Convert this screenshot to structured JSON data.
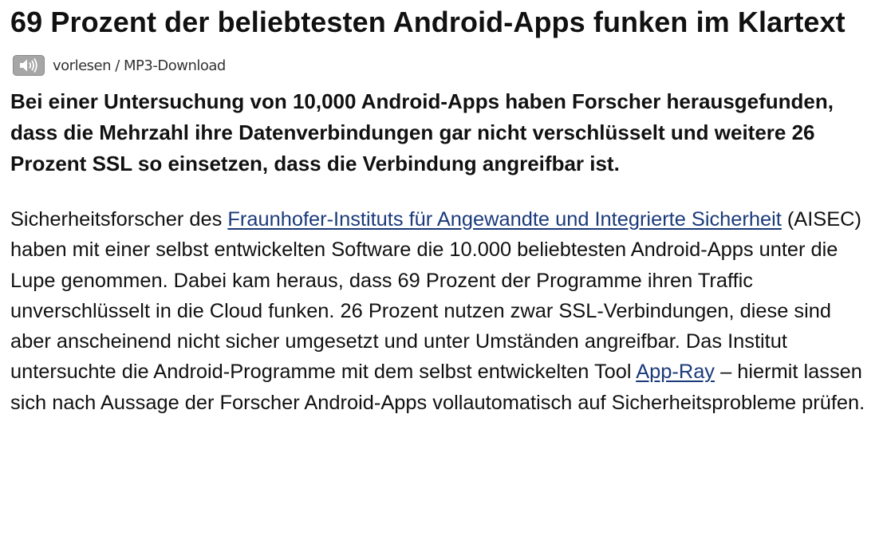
{
  "article": {
    "title": "69 Prozent der beliebtesten Android-Apps funken im Klartext",
    "audio": {
      "read_label": "vorlesen",
      "separator": " / ",
      "mp3_label": "MP3-Download"
    },
    "lead": "Bei einer Untersuchung von 10,000 Android-Apps haben Forscher herausgefunden, dass die Mehrzahl ihre Datenverbindungen gar nicht verschlüsselt und weitere 26 Prozent SSL so einsetzen, dass die Verbindung angreifbar ist.",
    "body": {
      "intro": "Sicherheitsforscher des ",
      "link_fraunhofer": "Fraunhofer-Instituts für Angewandte und Integrierte Sicherheit",
      "middle": " (AISEC) haben mit einer selbst entwickelten Software die 10.000 beliebtesten Android-Apps unter die Lupe genommen. Dabei kam heraus, dass 69 Prozent der Programme ihren Traffic unverschlüsselt in die Cloud funken. 26 Prozent nutzen zwar SSL-Verbindungen, diese sind aber anscheinend nicht sicher umgesetzt und unter Umständen angreifbar. Das Institut untersuchte die Android-Programme mit dem selbst entwickelten Tool ",
      "link_appray": "App-Ray",
      "end": " – hiermit lassen sich nach Aussage der Forscher Android-Apps vollautomatisch auf Sicherheitsprobleme prüfen."
    }
  },
  "colors": {
    "link": "#1a3a7a",
    "text": "#111111",
    "speaker_icon_bg": "#9a9a9a"
  },
  "icons": {
    "audio": "speaker-icon"
  }
}
